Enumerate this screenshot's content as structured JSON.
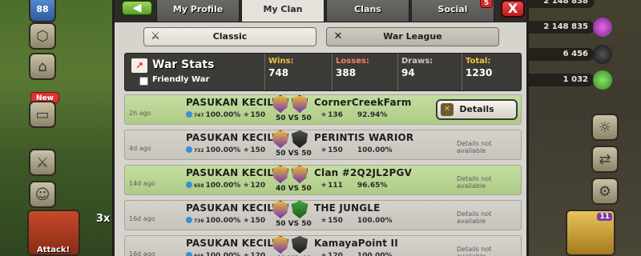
{
  "background": {
    "left_top_number": "88",
    "new_badge": "New",
    "bottom_number": "3x",
    "bottom_label": "Attack!",
    "resources": [
      "2 148 838",
      "2 148 835",
      "6 456",
      "1 032"
    ],
    "hud_badge": "11"
  },
  "tabs": {
    "back_icon": "back-arrow",
    "items": [
      {
        "label": "My Profile",
        "active": false
      },
      {
        "label": "My Clan",
        "active": true
      },
      {
        "label": "Clans",
        "active": false
      },
      {
        "label": "Social",
        "active": false
      }
    ],
    "notification_count": "5",
    "close_label": "X"
  },
  "modes": {
    "classic": "Classic",
    "war_league": "War League"
  },
  "stats": {
    "title": "War Stats",
    "friendly_war": "Friendly War",
    "wins_label": "Wins:",
    "wins": "748",
    "losses_label": "Losses:",
    "losses": "388",
    "draws_label": "Draws:",
    "draws": "94",
    "total_label": "Total:",
    "total": "1230"
  },
  "wars": [
    {
      "ago": "2h ago",
      "clan": "PASUKAN KECIL",
      "opponent": "CornerCreekFarm",
      "vs": "50 VS 50",
      "left_xp": "747",
      "left_pct": "100.00%",
      "left_stars": "150",
      "right_stars": "136",
      "right_pct": "92.94%",
      "result": "win",
      "action": "Details"
    },
    {
      "ago": "4d ago",
      "clan": "PASUKAN KECIL",
      "opponent": "PERINTIS WARIOR",
      "vs": "50 VS 50",
      "left_xp": "732",
      "left_pct": "100.00%",
      "left_stars": "150",
      "right_stars": "150",
      "right_pct": "100.00%",
      "result": "draw",
      "action": "Details not available"
    },
    {
      "ago": "14d ago",
      "clan": "PASUKAN KECIL",
      "opponent": "Clan #2Q2JL2PGV",
      "vs": "40 VS 50",
      "left_xp": "658",
      "left_pct": "100.00%",
      "left_stars": "120",
      "right_stars": "111",
      "right_pct": "96.65%",
      "result": "win",
      "action": "Details not available"
    },
    {
      "ago": "16d ago",
      "clan": "PASUKAN KECIL",
      "opponent": "THE JUNGLE",
      "vs": "50 VS 50",
      "left_xp": "736",
      "left_pct": "100.00%",
      "left_stars": "150",
      "right_stars": "150",
      "right_pct": "100.00%",
      "result": "draw",
      "action": "Details not available"
    },
    {
      "ago": "16d ago",
      "clan": "PASUKAN KECIL",
      "opponent": "KamayaPoint II",
      "vs": "40 VS 40",
      "left_xp": "605",
      "left_pct": "100.00%",
      "left_stars": "120",
      "right_stars": "120",
      "right_pct": "100.00%",
      "result": "draw",
      "action": "Details not available"
    }
  ],
  "colors": {
    "win_row": "#b8d590",
    "neutral_row": "#cecbc4",
    "panel": "#d6d4cc",
    "tab_bar": "#2c2b28"
  }
}
